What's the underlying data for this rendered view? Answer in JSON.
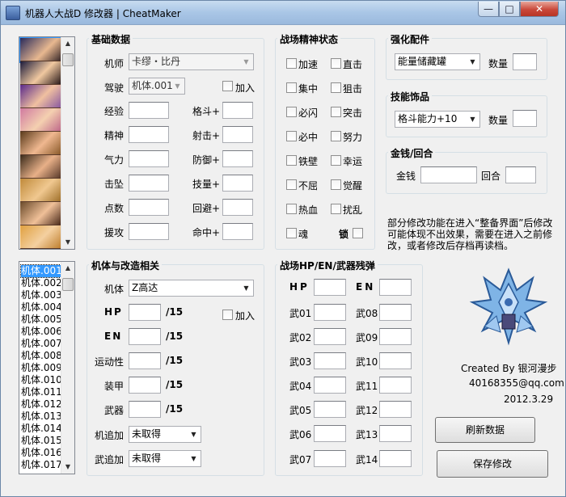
{
  "window": {
    "title": "机器人大战D 修改器 | CheatMaker",
    "min": "—",
    "max": "□",
    "close": "✕"
  },
  "basic": {
    "title": "基础数据",
    "pilot_label": "机师",
    "pilot_value": "卡缪・比丹",
    "drive_label": "驾驶",
    "drive_value": "机体.001",
    "join_label": "加入",
    "left_stats": [
      "经验",
      "精神",
      "气力",
      "击坠",
      "点数",
      "援攻"
    ],
    "right_stats": [
      "格斗+",
      "射击+",
      "防御+",
      "技量+",
      "回避+",
      "命中+"
    ]
  },
  "spirit": {
    "title": "战场精神状态",
    "left": [
      "加速",
      "集中",
      "必闪",
      "必中",
      "铁壁",
      "不屈",
      "热血",
      "魂"
    ],
    "right": [
      "直击",
      "狙击",
      "突击",
      "努力",
      "幸运",
      "觉醒",
      "扰乱"
    ],
    "lock": "锁"
  },
  "enhance": {
    "title": "强化配件",
    "value": "能量储藏罐",
    "qty_label": "数量"
  },
  "skill_item": {
    "title": "技能饰品",
    "value": "格斗能力+10",
    "qty_label": "数量"
  },
  "money": {
    "title": "金钱/回合",
    "money_label": "金钱",
    "round_label": "回合"
  },
  "note": "部分修改功能在进入“整备界面”后修改可能体现不出效果，需要在进入之前修改，或者修改后存档再读档。",
  "mech": {
    "title": "机体与改造相关",
    "mech_label": "机体",
    "mech_value": "Z高达",
    "hp": "HP",
    "en": "EN",
    "slash15": "/15",
    "join_label": "加入",
    "rows": [
      "运动性",
      "装甲",
      "武器"
    ],
    "extra1_label": "机追加",
    "extra1_value": "未取得",
    "extra2_label": "武追加",
    "extra2_value": "未取得"
  },
  "battle": {
    "title": "战场HP/EN/武器残弹",
    "hp": "HP",
    "en": "EN",
    "left": [
      "武01",
      "武02",
      "武03",
      "武04",
      "武05",
      "武06",
      "武07"
    ],
    "right": [
      "武08",
      "武09",
      "武10",
      "武11",
      "武12",
      "武13",
      "武14"
    ]
  },
  "credits": {
    "author": "Created By 银河漫步",
    "email": "40168355@qq.com",
    "date": "2012.3.29"
  },
  "buttons": {
    "refresh": "刷新数据",
    "save": "保存修改"
  },
  "mech_list": [
    "机体.001",
    "机体.002",
    "机体.003",
    "机体.004",
    "机体.005",
    "机体.006",
    "机体.007",
    "机体.008",
    "机体.009",
    "机体.010",
    "机体.011",
    "机体.012",
    "机体.013",
    "机体.014",
    "机体.015",
    "机体.016",
    "机体.017"
  ],
  "colors": {
    "selection": "#3399ff",
    "close_button": "#c9483a",
    "group_border": "#d5dfe5"
  }
}
